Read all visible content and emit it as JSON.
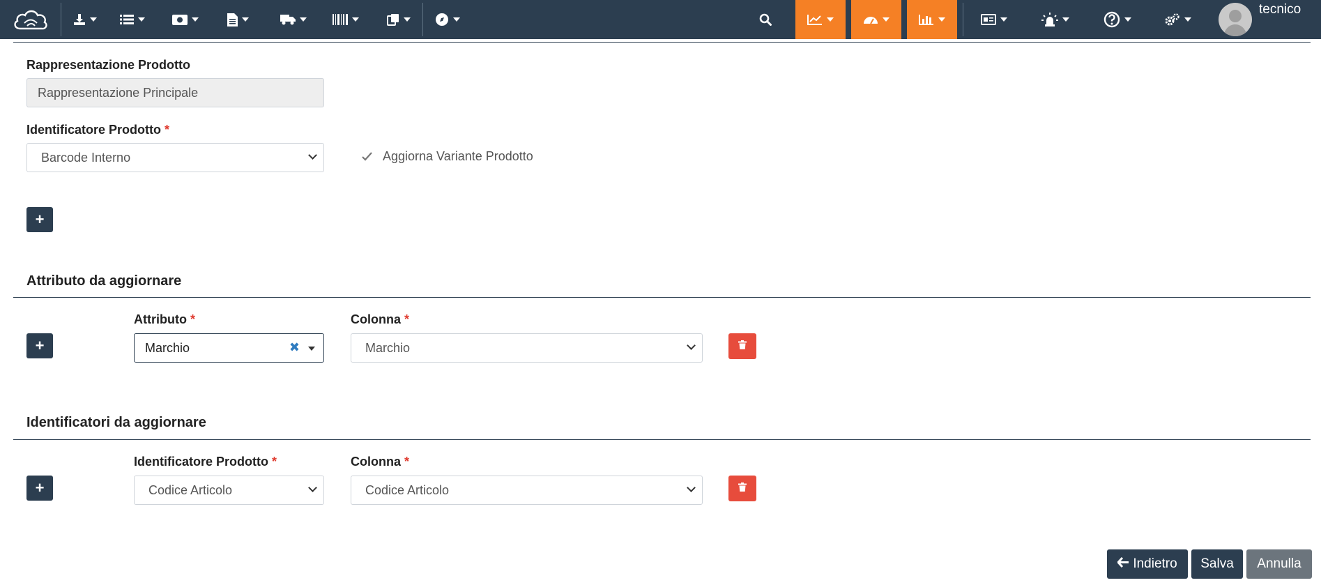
{
  "navbar": {
    "menus": [
      {
        "icon": "download-icon"
      },
      {
        "icon": "list-icon"
      },
      {
        "icon": "money-icon"
      },
      {
        "icon": "document-icon"
      },
      {
        "icon": "truck-icon"
      },
      {
        "icon": "barcode-icon"
      },
      {
        "icon": "clipboard-icon"
      },
      {
        "icon": "compass-icon"
      }
    ],
    "right_menus": [
      {
        "icon": "search-icon"
      },
      {
        "icon": "line-chart-icon",
        "highlight": true
      },
      {
        "icon": "dashboard-icon",
        "highlight": true
      },
      {
        "icon": "bar-chart-icon",
        "highlight": true
      },
      {
        "icon": "id-card-icon"
      },
      {
        "icon": "alarm-icon"
      },
      {
        "icon": "help-icon"
      },
      {
        "icon": "settings-icon"
      }
    ],
    "username": "tecnico",
    "accent_color": "#f58025",
    "bar_color": "#2c3e50"
  },
  "form": {
    "representation": {
      "label": "Rappresentazione Prodotto",
      "value": "Rappresentazione Principale"
    },
    "identifier": {
      "label": "Identificatore Prodotto",
      "required_mark": "*",
      "value": "Barcode Interno"
    },
    "update_variant": {
      "label": "Aggiorna Variante Prodotto",
      "checked": true
    },
    "add_button": "+"
  },
  "attributes_section": {
    "title": "Attributo da aggiornare",
    "row": {
      "attribute_label": "Attributo",
      "attribute_value": "Marchio",
      "clear_symbol": "✖",
      "column_label": "Colonna",
      "column_value": "Marchio",
      "required_mark": "*"
    }
  },
  "identifiers_section": {
    "title": "Identificatori da aggiornare",
    "row": {
      "identifier_label": "Identificatore Prodotto",
      "identifier_value": "Codice Articolo",
      "column_label": "Colonna",
      "column_value": "Codice Articolo",
      "required_mark": "*"
    }
  },
  "actions": {
    "back_label": "Indietro",
    "save_label": "Salva",
    "cancel_label": "Annulla"
  },
  "colors": {
    "danger": "#e74c3c",
    "primary_dark": "#2c3e50",
    "secondary": "#6c757d"
  }
}
